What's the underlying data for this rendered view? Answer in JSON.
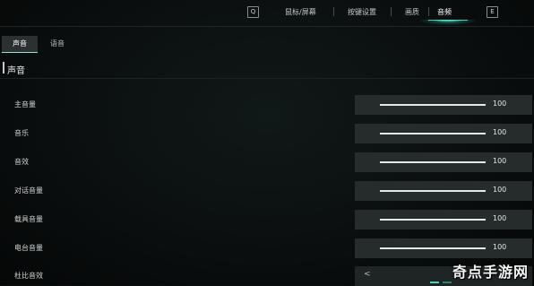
{
  "top_tabs": {
    "left_key": "Q",
    "right_key": "E",
    "items": [
      {
        "label": "鼠标/屏幕",
        "active": false
      },
      {
        "label": "按键设置",
        "active": false
      },
      {
        "label": "画质",
        "active": false
      },
      {
        "label": "音频",
        "active": true
      }
    ]
  },
  "sub_tabs": [
    {
      "label": "声音",
      "active": true
    },
    {
      "label": "语音",
      "active": false
    }
  ],
  "section": {
    "title": "声音"
  },
  "settings": [
    {
      "label": "主音量",
      "value": "100",
      "fraction": 1.0
    },
    {
      "label": "音乐",
      "value": "100",
      "fraction": 1.0
    },
    {
      "label": "音效",
      "value": "100",
      "fraction": 1.0
    },
    {
      "label": "对话音量",
      "value": "100",
      "fraction": 1.0
    },
    {
      "label": "载具音量",
      "value": "100",
      "fraction": 1.0
    },
    {
      "label": "电台音量",
      "value": "100",
      "fraction": 1.0
    }
  ],
  "dynamic_range": {
    "label": "杜比音效",
    "arrow": "<"
  },
  "watermark": "奇点手游网",
  "colors": {
    "accent": "#5fd9c4",
    "panel": "#262b2b",
    "background": "#0b0f0f"
  }
}
